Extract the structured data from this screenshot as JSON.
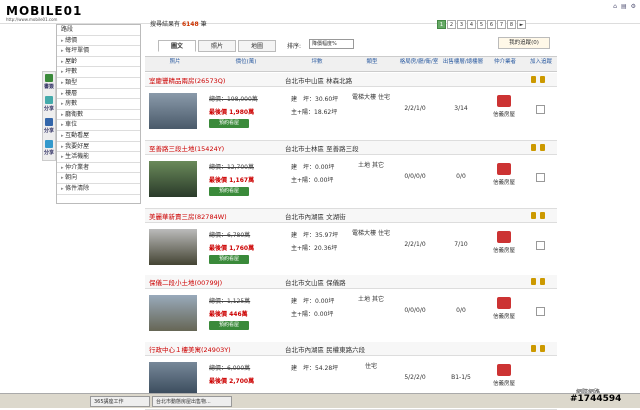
{
  "brand": {
    "logo": "MOBILE01",
    "url": "http://www.mobile01.com"
  },
  "result": {
    "label": "搜尋結果有",
    "count": "6148",
    "unit": "筆"
  },
  "pager": [
    "1",
    "2",
    "3",
    "4",
    "5",
    "6",
    "7",
    "8",
    "►"
  ],
  "tabs": [
    "圖文",
    "照片",
    "地圖"
  ],
  "sort": {
    "label": "排序:",
    "value": "降價幅度%"
  },
  "favorites": "我的追蹤(0)",
  "sidebar": [
    "路段",
    "總價",
    "每坪單價",
    "屋齡",
    "坪數",
    "類型",
    "樓層",
    "房數",
    "廳衛數",
    "車位",
    "互動看屋",
    "我要好屋",
    "生活機能",
    "仲介業者",
    "朝向",
    "條件清除"
  ],
  "share": [
    "書簽",
    "分享",
    "分享",
    "分享"
  ],
  "columns": [
    "照片",
    "價位(萬)",
    "坪數",
    "類型",
    "格局房/廳/衛/室",
    "出售樓層/總樓層",
    "仲介業者",
    "加入追蹤"
  ],
  "listings": [
    {
      "name": "室慶豐精品兩房(26573Q)",
      "addr": "台北市中山區 林森北路",
      "old": "總價：198,000萬",
      "new": "最後價 1,980萬",
      "area": "建　坪：30.60坪",
      "land": "主+陽：18.62坪",
      "type": "電梯大樓 住宅",
      "rooms": "2/2/1/0",
      "floor": "3/14",
      "agent": "信義房屋",
      "book": "預約看屋"
    },
    {
      "name": "至善路三段土地(15424Y)",
      "addr": "台北市士林區 至善路三段",
      "old": "總價：12,700萬",
      "new": "最後價 1,167萬",
      "area": "建　坪：0.00坪",
      "land": "主+陽：0.00坪",
      "type": "土地 其它",
      "rooms": "0/0/0/0",
      "floor": "0/0",
      "agent": "信義房屋",
      "book": "預約看屋"
    },
    {
      "name": "美麗華新賣三房(82784W)",
      "addr": "台北市內湖區 文湖街",
      "old": "總價：6,780萬",
      "new": "最後價 1,760萬",
      "area": "建　坪：35.97坪",
      "land": "主+陽：20.36坪",
      "type": "電梯大樓 住宅",
      "rooms": "2/2/1/0",
      "floor": "7/10",
      "agent": "信義房屋",
      "book": "預約看屋"
    },
    {
      "name": "保儀二段小土地(00799J)",
      "addr": "台北市文山區 保儀路",
      "old": "總價：1,125萬",
      "new": "最後價 446萬",
      "area": "建　坪：0.00坪",
      "land": "主+陽：0.00坪",
      "type": "土地 其它",
      "rooms": "0/0/0/0",
      "floor": "0/0",
      "agent": "信義房屋",
      "book": "預約看屋"
    },
    {
      "name": "行政中心１樓美寓(24903Y)",
      "addr": "台北市內湖區 民權東路六段",
      "old": "總價：6,000萬",
      "new": "最後價 2,700萬",
      "area": "建　坪：54.28坪",
      "land": "",
      "type": "住宅",
      "rooms": "5/2/2/0",
      "floor": "B1-1/5",
      "agent": "信義房屋",
      "book": "預約看屋"
    }
  ],
  "status": {
    "text": "網際網路"
  },
  "taskbar": [
    "365講座工作",
    "台北市動態房屋出售物..."
  ],
  "watermark": "#1744594"
}
